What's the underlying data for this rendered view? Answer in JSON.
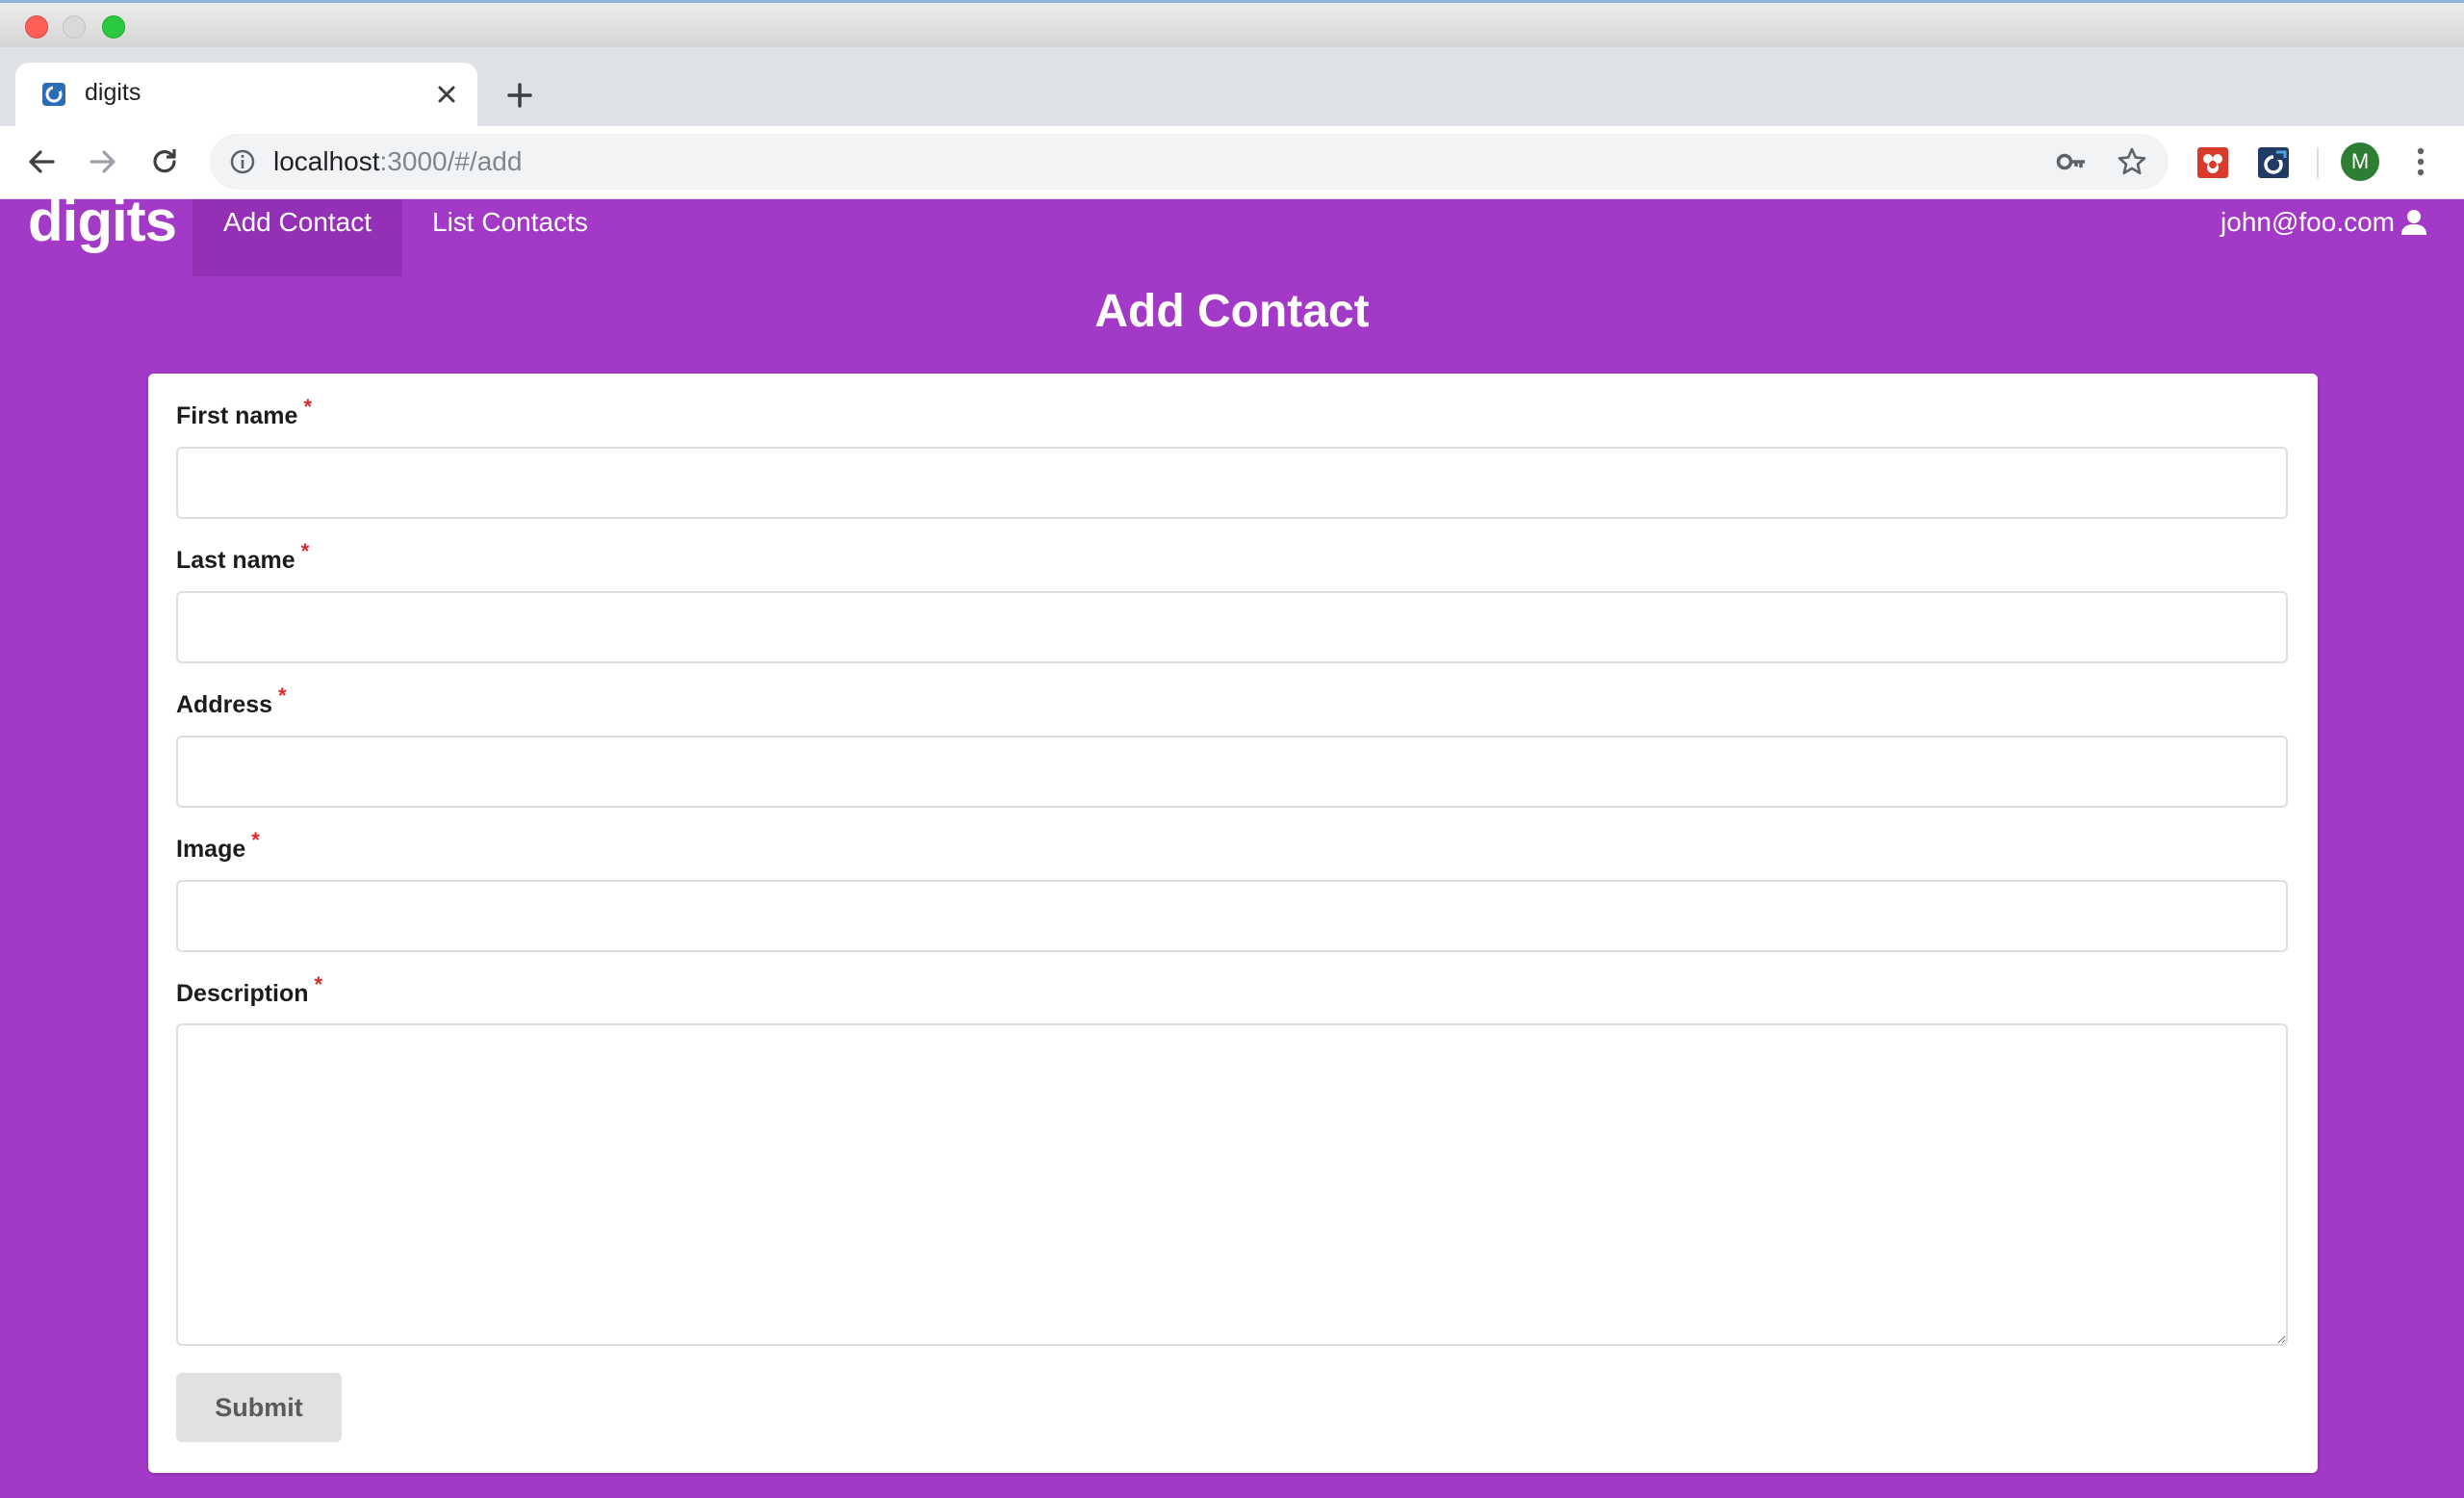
{
  "browser": {
    "tab_title": "digits",
    "url_host": "localhost",
    "url_rest": ":3000/#/add",
    "profile_initial": "M"
  },
  "navbar": {
    "brand": "digits",
    "items": [
      {
        "label": "Add Contact",
        "active": true
      },
      {
        "label": "List Contacts",
        "active": false
      }
    ],
    "user_email": "john@foo.com"
  },
  "page": {
    "title": "Add Contact"
  },
  "form": {
    "required_marker": "*",
    "fields": [
      {
        "label": "First name",
        "value": "",
        "required": true
      },
      {
        "label": "Last name",
        "value": "",
        "required": true
      },
      {
        "label": "Address",
        "value": "",
        "required": true
      },
      {
        "label": "Image",
        "value": "",
        "required": true
      },
      {
        "label": "Description",
        "value": "",
        "required": true
      }
    ],
    "submit_label": "Submit"
  },
  "colors": {
    "page_background": "#a339c7",
    "active_nav_background": "#9430b6",
    "required_marker": "#db2828",
    "submit_background": "#e0e1e2"
  },
  "icons": {
    "window_controls": [
      "close-light",
      "minimize-light",
      "zoom-light"
    ],
    "toolbar": [
      "back-icon",
      "forward-icon",
      "reload-icon",
      "info-icon",
      "key-icon",
      "star-icon",
      "extension-icon",
      "extension-icon",
      "avatar",
      "menu-icon"
    ],
    "user_menu": "user-icon"
  }
}
